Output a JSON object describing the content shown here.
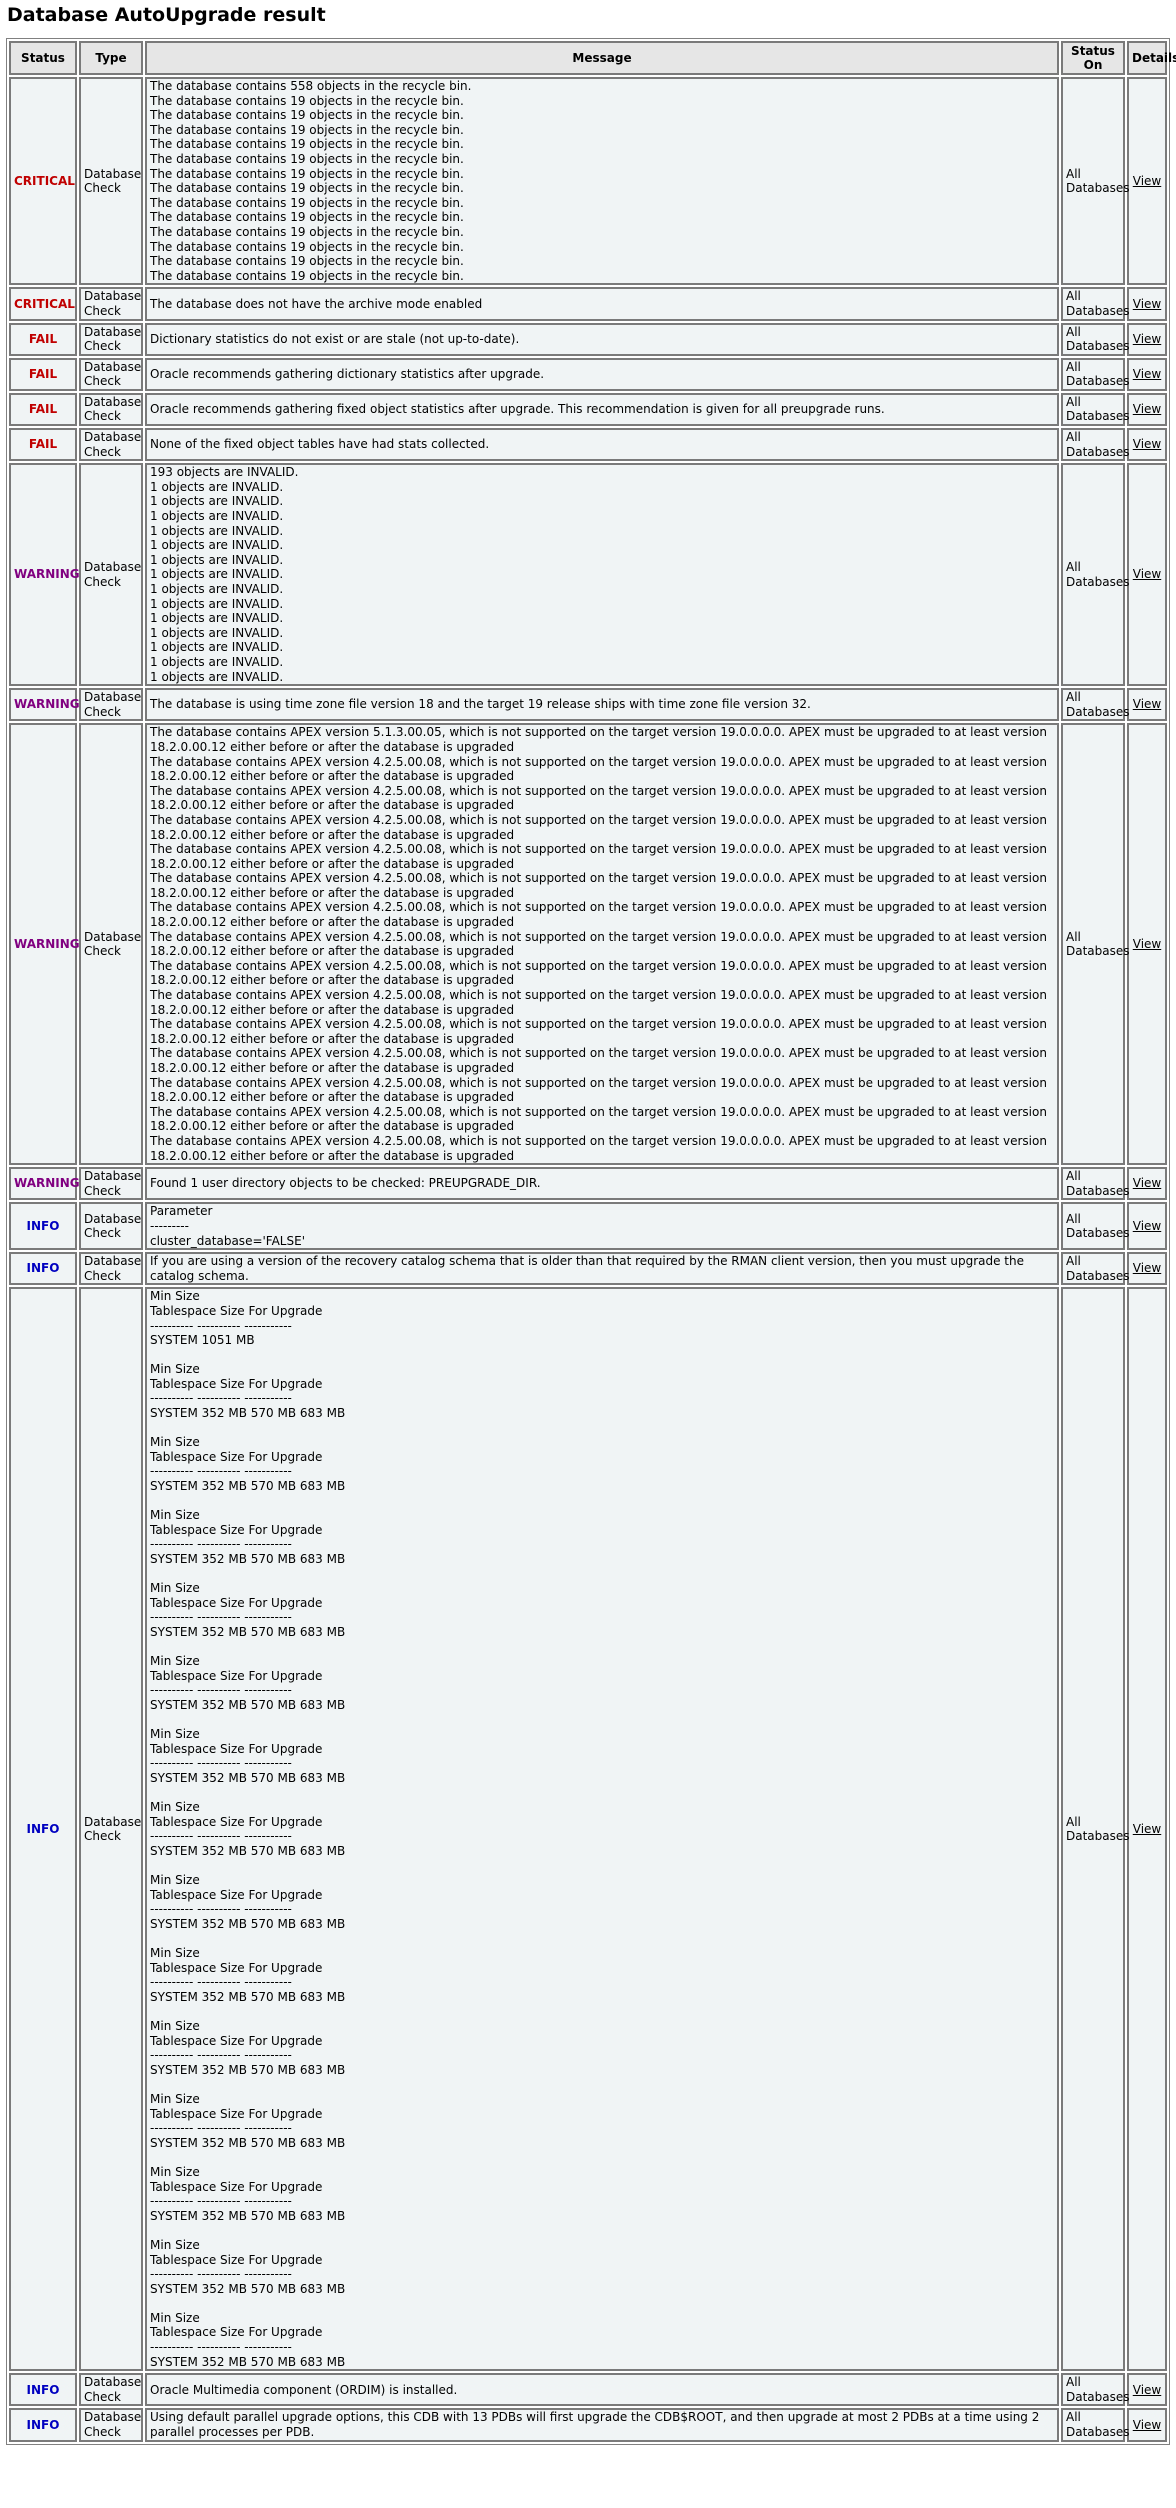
{
  "title": "Database AutoUpgrade result",
  "columns": {
    "status": "Status",
    "type": "Type",
    "message": "Message",
    "status_on": "Status On",
    "details": "Details"
  },
  "rows": [
    {
      "status": "CRITICAL",
      "severity": "critical",
      "type": "Database Check",
      "status_on": "All Databases",
      "details": "View",
      "lines": [
        "The database contains 558 objects in the recycle bin.",
        "The database contains 19 objects in the recycle bin.",
        "The database contains 19 objects in the recycle bin.",
        "The database contains 19 objects in the recycle bin.",
        "The database contains 19 objects in the recycle bin.",
        "The database contains 19 objects in the recycle bin.",
        "The database contains 19 objects in the recycle bin.",
        "The database contains 19 objects in the recycle bin.",
        "The database contains 19 objects in the recycle bin.",
        "The database contains 19 objects in the recycle bin.",
        "The database contains 19 objects in the recycle bin.",
        "The database contains 19 objects in the recycle bin.",
        "The database contains 19 objects in the recycle bin.",
        "The database contains 19 objects in the recycle bin."
      ]
    },
    {
      "status": "CRITICAL",
      "severity": "critical",
      "type": "Database Check",
      "status_on": "All Databases",
      "details": "View",
      "lines": [
        "The database does not have the archive mode enabled"
      ]
    },
    {
      "status": "FAIL",
      "severity": "fail",
      "type": "Database Check",
      "status_on": "All Databases",
      "details": "View",
      "lines": [
        "Dictionary statistics do not exist or are stale (not up-to-date)."
      ]
    },
    {
      "status": "FAIL",
      "severity": "fail",
      "type": "Database Check",
      "status_on": "All Databases",
      "details": "View",
      "lines": [
        "Oracle recommends gathering dictionary statistics after upgrade."
      ]
    },
    {
      "status": "FAIL",
      "severity": "fail",
      "type": "Database Check",
      "status_on": "All Databases",
      "details": "View",
      "lines": [
        "Oracle recommends gathering fixed object statistics after upgrade. This recommendation is given for all preupgrade runs."
      ]
    },
    {
      "status": "FAIL",
      "severity": "fail",
      "type": "Database Check",
      "status_on": "All Databases",
      "details": "View",
      "lines": [
        "None of the fixed object tables have had stats collected."
      ]
    },
    {
      "status": "WARNING",
      "severity": "warning",
      "type": "Database Check",
      "status_on": "All Databases",
      "details": "View",
      "lines": [
        "193 objects are INVALID.",
        "1 objects are INVALID.",
        "1 objects are INVALID.",
        "1 objects are INVALID.",
        "1 objects are INVALID.",
        "1 objects are INVALID.",
        "1 objects are INVALID.",
        "1 objects are INVALID.",
        "1 objects are INVALID.",
        "1 objects are INVALID.",
        "1 objects are INVALID.",
        "1 objects are INVALID.",
        "1 objects are INVALID.",
        "1 objects are INVALID.",
        "1 objects are INVALID."
      ]
    },
    {
      "status": "WARNING",
      "severity": "warning",
      "type": "Database Check",
      "status_on": "All Databases",
      "details": "View",
      "lines": [
        "The database is using time zone file version 18 and the target 19 release ships with time zone file version 32."
      ]
    },
    {
      "status": "WARNING",
      "severity": "warning",
      "type": "Database Check",
      "status_on": "All Databases",
      "details": "View",
      "lines": [
        "The database contains APEX version 5.1.3.00.05, which is not supported on the target version 19.0.0.0.0. APEX must be upgraded to at least version 18.2.0.00.12 either before or after the database is upgraded",
        "The database contains APEX version 4.2.5.00.08, which is not supported on the target version 19.0.0.0.0. APEX must be upgraded to at least version 18.2.0.00.12 either before or after the database is upgraded",
        "The database contains APEX version 4.2.5.00.08, which is not supported on the target version 19.0.0.0.0. APEX must be upgraded to at least version 18.2.0.00.12 either before or after the database is upgraded",
        "The database contains APEX version 4.2.5.00.08, which is not supported on the target version 19.0.0.0.0. APEX must be upgraded to at least version 18.2.0.00.12 either before or after the database is upgraded",
        "The database contains APEX version 4.2.5.00.08, which is not supported on the target version 19.0.0.0.0. APEX must be upgraded to at least version 18.2.0.00.12 either before or after the database is upgraded",
        "The database contains APEX version 4.2.5.00.08, which is not supported on the target version 19.0.0.0.0. APEX must be upgraded to at least version 18.2.0.00.12 either before or after the database is upgraded",
        "The database contains APEX version 4.2.5.00.08, which is not supported on the target version 19.0.0.0.0. APEX must be upgraded to at least version 18.2.0.00.12 either before or after the database is upgraded",
        "The database contains APEX version 4.2.5.00.08, which is not supported on the target version 19.0.0.0.0. APEX must be upgraded to at least version 18.2.0.00.12 either before or after the database is upgraded",
        "The database contains APEX version 4.2.5.00.08, which is not supported on the target version 19.0.0.0.0. APEX must be upgraded to at least version 18.2.0.00.12 either before or after the database is upgraded",
        "The database contains APEX version 4.2.5.00.08, which is not supported on the target version 19.0.0.0.0. APEX must be upgraded to at least version 18.2.0.00.12 either before or after the database is upgraded",
        "The database contains APEX version 4.2.5.00.08, which is not supported on the target version 19.0.0.0.0. APEX must be upgraded to at least version 18.2.0.00.12 either before or after the database is upgraded",
        "The database contains APEX version 4.2.5.00.08, which is not supported on the target version 19.0.0.0.0. APEX must be upgraded to at least version 18.2.0.00.12 either before or after the database is upgraded",
        "The database contains APEX version 4.2.5.00.08, which is not supported on the target version 19.0.0.0.0. APEX must be upgraded to at least version 18.2.0.00.12 either before or after the database is upgraded",
        "The database contains APEX version 4.2.5.00.08, which is not supported on the target version 19.0.0.0.0. APEX must be upgraded to at least version 18.2.0.00.12 either before or after the database is upgraded",
        "The database contains APEX version 4.2.5.00.08, which is not supported on the target version 19.0.0.0.0. APEX must be upgraded to at least version 18.2.0.00.12 either before or after the database is upgraded"
      ]
    },
    {
      "status": "WARNING",
      "severity": "warning",
      "type": "Database Check",
      "status_on": "All Databases",
      "details": "View",
      "lines": [
        "Found 1 user directory objects to be checked: PREUPGRADE_DIR."
      ]
    },
    {
      "status": "INFO",
      "severity": "info",
      "type": "Database Check",
      "status_on": "All Databases",
      "details": "View",
      "lines": [
        "Parameter",
        "---------",
        "cluster_database='FALSE'"
      ]
    },
    {
      "status": "INFO",
      "severity": "info",
      "type": "Database Check",
      "status_on": "All Databases",
      "details": "View",
      "lines": [
        "If you are using a version of the recovery catalog schema that is older than that required by the RMAN client version, then you must upgrade the catalog schema."
      ]
    },
    {
      "status": "INFO",
      "severity": "info",
      "type": "Database Check",
      "status_on": "All Databases",
      "details": "View",
      "lines": [
        "Min Size",
        "Tablespace Size For Upgrade",
        "---------- ---------- -----------",
        "SYSTEM 1051 MB",
        "",
        "Min Size",
        "Tablespace Size For Upgrade",
        "---------- ---------- -----------",
        "SYSTEM 352 MB 570 MB 683 MB",
        "",
        "Min Size",
        "Tablespace Size For Upgrade",
        "---------- ---------- -----------",
        "SYSTEM 352 MB 570 MB 683 MB",
        "",
        "Min Size",
        "Tablespace Size For Upgrade",
        "---------- ---------- -----------",
        "SYSTEM 352 MB 570 MB 683 MB",
        "",
        "Min Size",
        "Tablespace Size For Upgrade",
        "---------- ---------- -----------",
        "SYSTEM 352 MB 570 MB 683 MB",
        "",
        "Min Size",
        "Tablespace Size For Upgrade",
        "---------- ---------- -----------",
        "SYSTEM 352 MB 570 MB 683 MB",
        "",
        "Min Size",
        "Tablespace Size For Upgrade",
        "---------- ---------- -----------",
        "SYSTEM 352 MB 570 MB 683 MB",
        "",
        "Min Size",
        "Tablespace Size For Upgrade",
        "---------- ---------- -----------",
        "SYSTEM 352 MB 570 MB 683 MB",
        "",
        "Min Size",
        "Tablespace Size For Upgrade",
        "---------- ---------- -----------",
        "SYSTEM 352 MB 570 MB 683 MB",
        "",
        "Min Size",
        "Tablespace Size For Upgrade",
        "---------- ---------- -----------",
        "SYSTEM 352 MB 570 MB 683 MB",
        "",
        "Min Size",
        "Tablespace Size For Upgrade",
        "---------- ---------- -----------",
        "SYSTEM 352 MB 570 MB 683 MB",
        "",
        "Min Size",
        "Tablespace Size For Upgrade",
        "---------- ---------- -----------",
        "SYSTEM 352 MB 570 MB 683 MB",
        "",
        "Min Size",
        "Tablespace Size For Upgrade",
        "---------- ---------- -----------",
        "SYSTEM 352 MB 570 MB 683 MB",
        "",
        "Min Size",
        "Tablespace Size For Upgrade",
        "---------- ---------- -----------",
        "SYSTEM 352 MB 570 MB 683 MB",
        "",
        "Min Size",
        "Tablespace Size For Upgrade",
        "---------- ---------- -----------",
        "SYSTEM 352 MB 570 MB 683 MB"
      ]
    },
    {
      "status": "INFO",
      "severity": "info",
      "type": "Database Check",
      "status_on": "All Databases",
      "details": "View",
      "lines": [
        "Oracle Multimedia component (ORDIM) is installed."
      ]
    },
    {
      "status": "INFO",
      "severity": "info",
      "type": "Database Check",
      "status_on": "All Databases",
      "details": "View",
      "lines": [
        "Using default parallel upgrade options, this CDB with 13 PDBs will first upgrade the CDB$ROOT, and then upgrade at most 2 PDBs at a time using 2 parallel processes per PDB."
      ]
    }
  ]
}
